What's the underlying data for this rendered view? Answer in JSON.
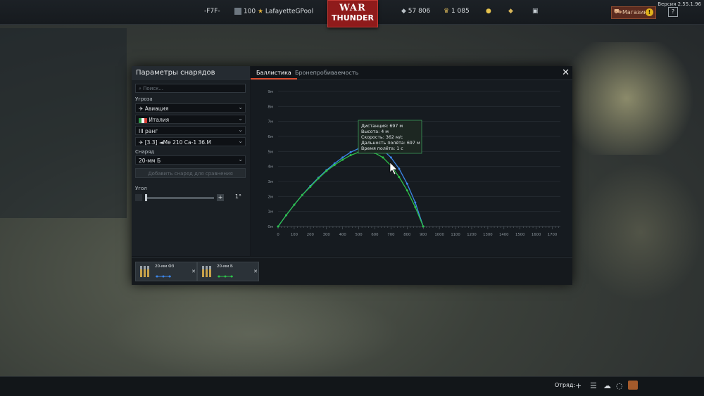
{
  "topbar": {
    "squad_tag": "-F7F-",
    "player_level": "100",
    "player_name": "LafayetteGPool",
    "silver_lions": "57 806",
    "golden_eagles": "1 085",
    "logo_line1": "WAR",
    "logo_line2": "THUNDER",
    "shop_label": "Магазин",
    "shop_alert": "!",
    "help_label": "?",
    "version": "Версия 2.55.1.96"
  },
  "modal": {
    "title": "Параметры снарядов",
    "search_placeholder": "Поиск...",
    "threat_label": "Угроза",
    "threat_value": "Авиация",
    "country_value": "Италия",
    "rank_value": "III ранг",
    "vehicle_value": "[3.3] ◄Me 210 Ca-1 36.M",
    "shell_label": "Снаряд",
    "shell_value": "20-мм Б",
    "add_compare_button": "Добавить снаряд для сравнения",
    "angle_label": "Угол",
    "angle_value": "1°",
    "tabs": [
      "Баллистика",
      "Бронепробиваемость"
    ],
    "close_icon": "close-icon",
    "tooltip": {
      "distance": "Дистанция: 697 м",
      "height": "Высота: 4 м",
      "speed": "Скорость: 362 м/с",
      "range": "Дальность полёта: 697 м",
      "time": "Время полёта: 1 с"
    },
    "compare_shells": [
      {
        "name": "20-мм ФЗ",
        "color": "#3c86e8"
      },
      {
        "name": "20-мм Б",
        "color": "#2ec24a"
      }
    ]
  },
  "chart_data": {
    "type": "line",
    "x_ticks": [
      "0",
      "100",
      "200",
      "300",
      "400",
      "500",
      "600",
      "700",
      "800",
      "900",
      "1000",
      "1100",
      "1200",
      "1300",
      "1400",
      "1500",
      "1600",
      "1700"
    ],
    "y_ticks": [
      "0м",
      "1м",
      "2м",
      "3м",
      "4м",
      "5м",
      "6м",
      "7м",
      "8м",
      "9м"
    ],
    "xlim": [
      0,
      1750
    ],
    "ylim": [
      0,
      9
    ],
    "series": [
      {
        "name": "20-мм ФЗ",
        "color": "#3c86e8",
        "x": [
          0,
          50,
          100,
          150,
          200,
          250,
          300,
          350,
          400,
          450,
          500,
          550,
          600,
          650,
          700,
          750,
          800,
          850,
          900
        ],
        "y": [
          0,
          0.75,
          1.45,
          2.1,
          2.7,
          3.25,
          3.75,
          4.2,
          4.6,
          4.95,
          5.2,
          5.35,
          5.35,
          5.1,
          4.6,
          3.85,
          2.85,
          1.6,
          0
        ]
      },
      {
        "name": "20-мм Б",
        "color": "#2ec24a",
        "x": [
          0,
          50,
          100,
          150,
          200,
          250,
          300,
          350,
          400,
          450,
          500,
          550,
          600,
          650,
          700,
          750,
          800,
          850,
          900
        ],
        "y": [
          0,
          0.75,
          1.45,
          2.1,
          2.65,
          3.2,
          3.7,
          4.1,
          4.45,
          4.75,
          4.95,
          5.0,
          4.9,
          4.6,
          4.05,
          3.3,
          2.4,
          1.3,
          0
        ]
      }
    ]
  },
  "footer": {
    "squad_label": "Отряд:"
  }
}
